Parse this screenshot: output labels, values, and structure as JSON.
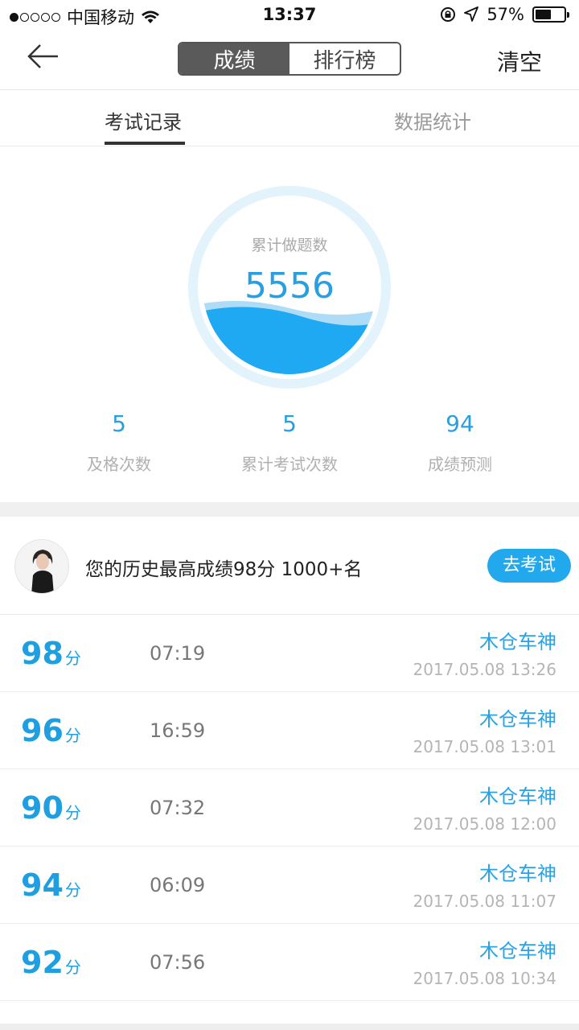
{
  "status_bar": {
    "carrier": "中国移动",
    "time": "13:37",
    "battery": "57%"
  },
  "nav": {
    "tabs": [
      "成绩",
      "排行榜"
    ],
    "active_index": 0,
    "clear_label": "清空"
  },
  "sub_tabs": [
    "考试记录",
    "数据统计"
  ],
  "summary": {
    "label": "累计做题数",
    "value": "5556"
  },
  "stats": [
    {
      "value": "5",
      "label": "及格次数"
    },
    {
      "value": "5",
      "label": "累计考试次数"
    },
    {
      "value": "94",
      "label": "成绩预测"
    }
  ],
  "best": {
    "text": "您的历史最高成绩98分 1000+名",
    "button": "去考试"
  },
  "score_unit": "分",
  "records": [
    {
      "score": "98",
      "duration": "07:19",
      "name": "木仓车神",
      "date": "2017.05.08 13:26"
    },
    {
      "score": "96",
      "duration": "16:59",
      "name": "木仓车神",
      "date": "2017.05.08 13:01"
    },
    {
      "score": "90",
      "duration": "07:32",
      "name": "木仓车神",
      "date": "2017.05.08 12:00"
    },
    {
      "score": "94",
      "duration": "06:09",
      "name": "木仓车神",
      "date": "2017.05.08 11:07"
    },
    {
      "score": "92",
      "duration": "07:56",
      "name": "木仓车神",
      "date": "2017.05.08 10:34"
    }
  ],
  "colors": {
    "accent": "#22a8ec",
    "wave": "#1ea9f2",
    "ring": "#e3f3fc"
  }
}
